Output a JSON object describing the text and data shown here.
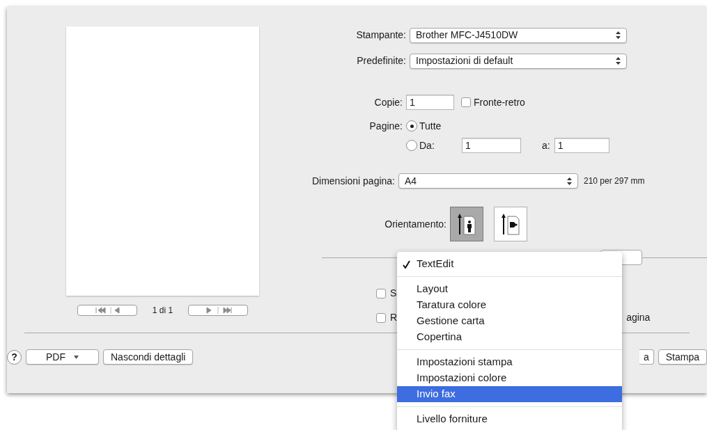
{
  "printer": {
    "label": "Stampante:",
    "value": "Brother MFC-J4510DW"
  },
  "presets": {
    "label": "Predefinite:",
    "value": "Impostazioni di default"
  },
  "copies": {
    "label": "Copie:",
    "value": "1"
  },
  "two_sided": {
    "label": "Fronte-retro",
    "checked": false
  },
  "pages": {
    "label": "Pagine:",
    "options": [
      {
        "label": "Tutte",
        "selected": true
      },
      {
        "label": "Da:",
        "selected": false
      }
    ],
    "from": "1",
    "to_label": "a:",
    "to": "1"
  },
  "paper_size": {
    "label": "Dimensioni pagina:",
    "value": "A4",
    "size": "210 per 297 mm"
  },
  "orientation": {
    "label": "Orientamento:",
    "options": [
      {
        "kind": "portrait",
        "selected": true
      },
      {
        "kind": "landscape",
        "selected": false
      }
    ]
  },
  "preview": {
    "page_counter": "1 di 1"
  },
  "hidden_options": [
    {
      "label": "S",
      "checked": false
    },
    {
      "label": "R",
      "checked": false
    }
  ],
  "hidden_text": "agina",
  "menu": {
    "sections": [
      [
        {
          "label": "TextEdit",
          "checked": true,
          "selected": false
        }
      ],
      [
        {
          "label": "Layout",
          "checked": false,
          "selected": false
        },
        {
          "label": "Taratura colore",
          "checked": false,
          "selected": false
        },
        {
          "label": "Gestione carta",
          "checked": false,
          "selected": false
        },
        {
          "label": "Copertina",
          "checked": false,
          "selected": false
        }
      ],
      [
        {
          "label": "Impostazioni stampa",
          "checked": false,
          "selected": false
        },
        {
          "label": "Impostazioni colore",
          "checked": false,
          "selected": false
        },
        {
          "label": "Invio fax",
          "checked": false,
          "selected": true
        }
      ],
      [
        {
          "label": "Livello forniture",
          "checked": false,
          "selected": false
        }
      ]
    ]
  },
  "footer": {
    "help": "?",
    "pdf": "PDF",
    "details": "Nascondi dettagli",
    "cancel": "a",
    "print": "Stampa"
  }
}
